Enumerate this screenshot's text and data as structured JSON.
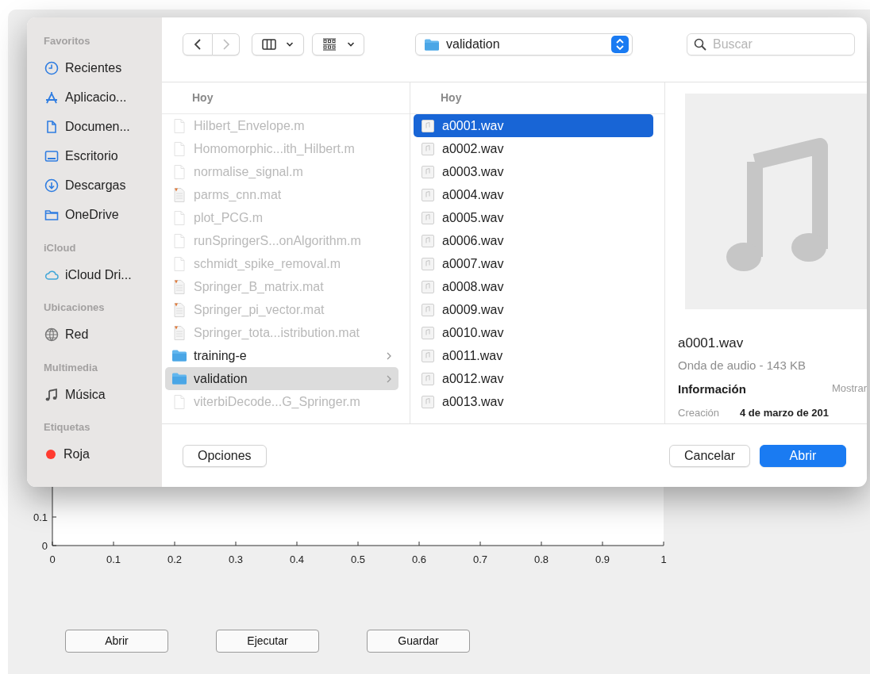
{
  "app": {
    "chart_data": {
      "type": "line",
      "xlim": [
        0,
        1
      ],
      "ylim": [
        0,
        1
      ],
      "xticks": [
        0,
        0.1,
        0.2,
        0.3,
        0.4,
        0.5,
        0.6,
        0.7,
        0.8,
        0.9,
        1
      ],
      "yticks": [
        0,
        0.1
      ]
    },
    "buttons": [
      "Abrir",
      "Ejecutar",
      "Guardar"
    ]
  },
  "dialog": {
    "toolbar": {
      "location": "validation",
      "search": {
        "placeholder": "Buscar"
      }
    },
    "sidebar": [
      {
        "title": "Favoritos",
        "items": [
          {
            "label": "Recientes",
            "kind": "clock"
          },
          {
            "label": "Aplicacio...",
            "kind": "apps"
          },
          {
            "label": "Documen...",
            "kind": "document"
          },
          {
            "label": "Escritorio",
            "kind": "desktop"
          },
          {
            "label": "Descargas",
            "kind": "download"
          },
          {
            "label": "OneDrive",
            "kind": "folder"
          }
        ]
      },
      {
        "title": "iCloud",
        "items": [
          {
            "label": "iCloud Dri...",
            "kind": "cloud"
          }
        ]
      },
      {
        "title": "Ubicaciones",
        "items": [
          {
            "label": "Red",
            "kind": "globe"
          }
        ]
      },
      {
        "title": "Multimedia",
        "items": [
          {
            "label": "Música",
            "kind": "music"
          }
        ]
      },
      {
        "title": "Etiquetas",
        "items": [
          {
            "label": "Roja",
            "kind": "tag",
            "color": "#ff3b30"
          }
        ]
      }
    ],
    "columns": [
      {
        "header": "Hoy",
        "items": [
          {
            "name": "Hilbert_Envelope.m",
            "kind": "doc",
            "disabled": true,
            "selected": false
          },
          {
            "name": "Homomorphic...ith_Hilbert.m",
            "kind": "doc",
            "disabled": true,
            "selected": false
          },
          {
            "name": "normalise_signal.m",
            "kind": "doc",
            "disabled": true,
            "selected": false
          },
          {
            "name": "parms_cnn.mat",
            "kind": "mat",
            "disabled": true,
            "selected": false
          },
          {
            "name": "plot_PCG.m",
            "kind": "doc",
            "disabled": true,
            "selected": false
          },
          {
            "name": "runSpringerS...onAlgorithm.m",
            "kind": "doc",
            "disabled": true,
            "selected": false
          },
          {
            "name": "schmidt_spike_removal.m",
            "kind": "doc",
            "disabled": true,
            "selected": false
          },
          {
            "name": "Springer_B_matrix.mat",
            "kind": "mat",
            "disabled": true,
            "selected": false
          },
          {
            "name": "Springer_pi_vector.mat",
            "kind": "mat",
            "disabled": true,
            "selected": false
          },
          {
            "name": "Springer_tota...istribution.mat",
            "kind": "mat",
            "disabled": true,
            "selected": false
          },
          {
            "name": "training-e",
            "kind": "folder",
            "disabled": false,
            "selected": false
          },
          {
            "name": "validation",
            "kind": "folder",
            "disabled": false,
            "selected": true
          },
          {
            "name": "viterbiDecode...G_Springer.m",
            "kind": "doc",
            "disabled": true,
            "selected": false
          }
        ]
      },
      {
        "header": "Hoy",
        "items": [
          {
            "name": "a0001.wav",
            "kind": "wav",
            "disabled": false,
            "selected": true
          },
          {
            "name": "a0002.wav",
            "kind": "wav",
            "disabled": false,
            "selected": false
          },
          {
            "name": "a0003.wav",
            "kind": "wav",
            "disabled": false,
            "selected": false
          },
          {
            "name": "a0004.wav",
            "kind": "wav",
            "disabled": false,
            "selected": false
          },
          {
            "name": "a0005.wav",
            "kind": "wav",
            "disabled": false,
            "selected": false
          },
          {
            "name": "a0006.wav",
            "kind": "wav",
            "disabled": false,
            "selected": false
          },
          {
            "name": "a0007.wav",
            "kind": "wav",
            "disabled": false,
            "selected": false
          },
          {
            "name": "a0008.wav",
            "kind": "wav",
            "disabled": false,
            "selected": false
          },
          {
            "name": "a0009.wav",
            "kind": "wav",
            "disabled": false,
            "selected": false
          },
          {
            "name": "a0010.wav",
            "kind": "wav",
            "disabled": false,
            "selected": false
          },
          {
            "name": "a0011.wav",
            "kind": "wav",
            "disabled": false,
            "selected": false
          },
          {
            "name": "a0012.wav",
            "kind": "wav",
            "disabled": false,
            "selected": false
          },
          {
            "name": "a0013.wav",
            "kind": "wav",
            "disabled": false,
            "selected": false
          }
        ]
      }
    ],
    "preview": {
      "name": "a0001.wav",
      "subtitle": "Onda de audio - 143 KB",
      "info_title": "Información",
      "info_action": "Mostrar",
      "fields": [
        {
          "label": "Creación",
          "value": "4 de marzo de 201"
        }
      ]
    },
    "footer": {
      "options": "Opciones",
      "cancel": "Cancelar",
      "confirm": "Abrir"
    }
  }
}
